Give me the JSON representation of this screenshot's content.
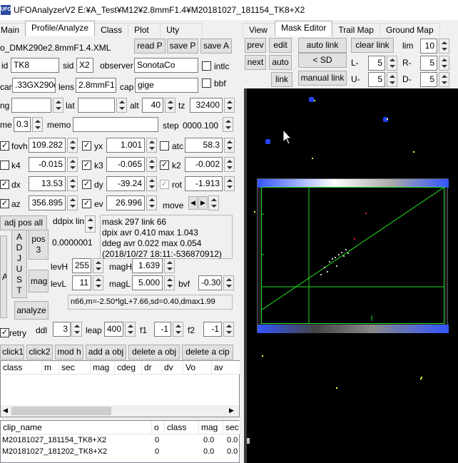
{
  "window": {
    "app_icon_text": "UFO",
    "title": "UFOAnalyzerV2 E:¥A_Test¥M12¥2.8mmF1.4¥M20181027_181154_TK8+X2"
  },
  "left_tabs": [
    "Main",
    "Profile/Analyze",
    "Class",
    "Plot",
    "Uty"
  ],
  "right_tabs": [
    "View",
    "Mask Editor",
    "Trail Map",
    "Ground Map"
  ],
  "profile": {
    "file": "o_DMK290e2.8mmF1.4.XML",
    "read_p": "read P",
    "save_p": "save P",
    "save_a": "save A",
    "id_label": "id",
    "id": "TK8",
    "sid_label": "sid",
    "sid": "X2",
    "observer_label": "observer",
    "observer": "SonotaCo",
    "intlc_label": "intlc",
    "cam_label": "cam",
    "cam": ".33GX290e",
    "lens_label": "lens",
    "lens": "2.8mmF1.4",
    "cap_label": "cap",
    "cap": "gige",
    "bbf_label": "bbf",
    "lng_label": "ng",
    "lng": "",
    "lat_label": "lat",
    "lat": "",
    "alt_label": "alt",
    "alt": "40",
    "tz_label": "tz",
    "tz": "32400",
    "frame_label": "me",
    "frame": "0.3",
    "memo_label": "memo",
    "memo": "",
    "step_label": "step",
    "step": "0000.100"
  },
  "params": {
    "fovh_label": "fovh",
    "fovh": "109.282",
    "yx_label": "yx",
    "yx": "1.001",
    "atc_label": "atc",
    "atc": "58.3",
    "k4_label": "k4",
    "k4": "-0.015",
    "k3_label": "k3",
    "k3": "-0.065",
    "k2_label": "k2",
    "k2": "-0.002",
    "dx_label": "dx",
    "dx": "13.53",
    "dy_label": "dy",
    "dy": "-39.24",
    "rot_label": "rot",
    "rot": "-1.913",
    "az_label": "az",
    "az": "356.895",
    "ev_label": "ev",
    "ev": "26.996",
    "move_label": "move"
  },
  "analyze": {
    "adj_pos_all": "adj pos all",
    "ddpix_label": "ddpix lin",
    "info_lines": [
      "mask 297  link 66",
      "dpix avr  0.410 max  1.043",
      "ddeg avr  0.022 max  0.054",
      "(2018/10/27 18:11:-536870912)"
    ],
    "adjust_letters": [
      "A",
      "D",
      "J",
      "U",
      "S",
      "T"
    ],
    "a_button": "A",
    "pos3_line1": "pos",
    "pos3_line2": "3",
    "value_small": "0.0000001",
    "mag_button": "mag",
    "analyze_button": "analyze",
    "levH_label": "levH",
    "levH": "255",
    "magH_label": "magH",
    "magH": "1.639",
    "levL_label": "levL",
    "levL": "11",
    "magL_label": "magL",
    "magL": "5.000",
    "bvf_label": "bvf",
    "bvf": "-0.30",
    "formula": "n66,m=-2.50*lgL+7.66,sd=0.40,dmax1.99",
    "retry_label": "retry",
    "ddl_label": "ddl",
    "ddl": "3",
    "leap_label": "leap",
    "leap": "400",
    "f1_label": "f1",
    "f1": "-1",
    "f2_label": "f2",
    "f2": "-1"
  },
  "actions": [
    "click1",
    "click2",
    "mod h",
    "add a obj",
    "delete a obj",
    "delete a cip"
  ],
  "obj_table": {
    "headers": [
      "class",
      "m",
      "sec",
      "mag",
      "cdeg",
      "dr",
      "dv",
      "Vo",
      "av"
    ]
  },
  "clip_table": {
    "headers": [
      "clip_name",
      "o",
      "class",
      "mag",
      "sec"
    ],
    "rows": [
      [
        "M20181027_181154_TK8+X2",
        "0",
        "",
        "0.0",
        "0.0"
      ],
      [
        "M20181027_181202_TK8+X2",
        "0",
        "",
        "0.0",
        "0.0"
      ]
    ]
  },
  "mask_editor": {
    "prev": "prev",
    "edit": "edit",
    "auto_link": "auto link",
    "clear_link": "clear link",
    "lim_label": "lim",
    "lim": "10",
    "next": "next",
    "auto": "auto",
    "lt_sd": "< SD",
    "L_label": "L-",
    "L": "5",
    "R_label": "R-",
    "R": "5",
    "link": "link",
    "manual_link": "manual link",
    "U_label": "U-",
    "U": "5",
    "D_label": "D-",
    "D": "5"
  },
  "colors": {
    "accent_green": "#22dd22",
    "mask_blue": "#2440ff",
    "background": "#f0f0f0"
  }
}
